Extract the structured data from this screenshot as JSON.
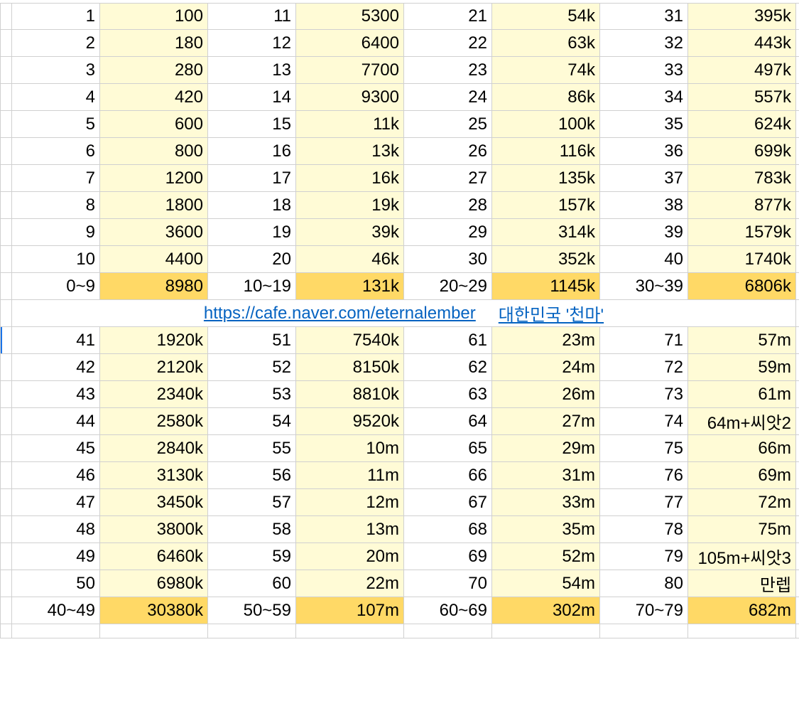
{
  "top_block": {
    "rows": [
      [
        {
          "k": "1",
          "v": "100"
        },
        {
          "k": "11",
          "v": "5300"
        },
        {
          "k": "21",
          "v": "54k"
        },
        {
          "k": "31",
          "v": "395k"
        }
      ],
      [
        {
          "k": "2",
          "v": "180"
        },
        {
          "k": "12",
          "v": "6400"
        },
        {
          "k": "22",
          "v": "63k"
        },
        {
          "k": "32",
          "v": "443k"
        }
      ],
      [
        {
          "k": "3",
          "v": "280"
        },
        {
          "k": "13",
          "v": "7700"
        },
        {
          "k": "23",
          "v": "74k"
        },
        {
          "k": "33",
          "v": "497k"
        }
      ],
      [
        {
          "k": "4",
          "v": "420"
        },
        {
          "k": "14",
          "v": "9300"
        },
        {
          "k": "24",
          "v": "86k"
        },
        {
          "k": "34",
          "v": "557k"
        }
      ],
      [
        {
          "k": "5",
          "v": "600"
        },
        {
          "k": "15",
          "v": "11k"
        },
        {
          "k": "25",
          "v": "100k"
        },
        {
          "k": "35",
          "v": "624k"
        }
      ],
      [
        {
          "k": "6",
          "v": "800"
        },
        {
          "k": "16",
          "v": "13k"
        },
        {
          "k": "26",
          "v": "116k"
        },
        {
          "k": "36",
          "v": "699k"
        }
      ],
      [
        {
          "k": "7",
          "v": "1200"
        },
        {
          "k": "17",
          "v": "16k"
        },
        {
          "k": "27",
          "v": "135k"
        },
        {
          "k": "37",
          "v": "783k"
        }
      ],
      [
        {
          "k": "8",
          "v": "1800"
        },
        {
          "k": "18",
          "v": "19k"
        },
        {
          "k": "28",
          "v": "157k"
        },
        {
          "k": "38",
          "v": "877k"
        }
      ],
      [
        {
          "k": "9",
          "v": "3600"
        },
        {
          "k": "19",
          "v": "39k"
        },
        {
          "k": "29",
          "v": "314k"
        },
        {
          "k": "39",
          "v": "1579k"
        }
      ],
      [
        {
          "k": "10",
          "v": "4400"
        },
        {
          "k": "20",
          "v": "46k"
        },
        {
          "k": "30",
          "v": "352k"
        },
        {
          "k": "40",
          "v": "1740k"
        }
      ]
    ],
    "sum": [
      {
        "k": "0~9",
        "v": "8980"
      },
      {
        "k": "10~19",
        "v": "131k"
      },
      {
        "k": "20~29",
        "v": "1145k"
      },
      {
        "k": "30~39",
        "v": "6806k"
      }
    ]
  },
  "link": {
    "url_text": "https://cafe.naver.com/eternalember",
    "extra_text": "대한민국 '천마'"
  },
  "bottom_block": {
    "rows": [
      [
        {
          "k": "41",
          "v": "1920k"
        },
        {
          "k": "51",
          "v": "7540k"
        },
        {
          "k": "61",
          "v": "23m"
        },
        {
          "k": "71",
          "v": "57m"
        }
      ],
      [
        {
          "k": "42",
          "v": "2120k"
        },
        {
          "k": "52",
          "v": "8150k"
        },
        {
          "k": "62",
          "v": "24m"
        },
        {
          "k": "72",
          "v": "59m"
        }
      ],
      [
        {
          "k": "43",
          "v": "2340k"
        },
        {
          "k": "53",
          "v": "8810k"
        },
        {
          "k": "63",
          "v": "26m"
        },
        {
          "k": "73",
          "v": "61m"
        }
      ],
      [
        {
          "k": "44",
          "v": "2580k"
        },
        {
          "k": "54",
          "v": "9520k"
        },
        {
          "k": "64",
          "v": "27m"
        },
        {
          "k": "74",
          "v": "64m+씨앗2"
        }
      ],
      [
        {
          "k": "45",
          "v": "2840k"
        },
        {
          "k": "55",
          "v": "10m"
        },
        {
          "k": "65",
          "v": "29m"
        },
        {
          "k": "75",
          "v": "66m"
        }
      ],
      [
        {
          "k": "46",
          "v": "3130k"
        },
        {
          "k": "56",
          "v": "11m"
        },
        {
          "k": "66",
          "v": "31m"
        },
        {
          "k": "76",
          "v": "69m"
        }
      ],
      [
        {
          "k": "47",
          "v": "3450k"
        },
        {
          "k": "57",
          "v": "12m"
        },
        {
          "k": "67",
          "v": "33m"
        },
        {
          "k": "77",
          "v": "72m"
        }
      ],
      [
        {
          "k": "48",
          "v": "3800k"
        },
        {
          "k": "58",
          "v": "13m"
        },
        {
          "k": "68",
          "v": "35m"
        },
        {
          "k": "78",
          "v": "75m"
        }
      ],
      [
        {
          "k": "49",
          "v": "6460k"
        },
        {
          "k": "59",
          "v": "20m"
        },
        {
          "k": "69",
          "v": "52m"
        },
        {
          "k": "79",
          "v": "105m+씨앗3"
        }
      ],
      [
        {
          "k": "50",
          "v": "6980k"
        },
        {
          "k": "60",
          "v": "22m"
        },
        {
          "k": "70",
          "v": "54m"
        },
        {
          "k": "80",
          "v": "만렙"
        }
      ]
    ],
    "sum": [
      {
        "k": "40~49",
        "v": "30380k"
      },
      {
        "k": "50~59",
        "v": "107m"
      },
      {
        "k": "60~69",
        "v": "302m"
      },
      {
        "k": "70~79",
        "v": "682m"
      }
    ]
  }
}
